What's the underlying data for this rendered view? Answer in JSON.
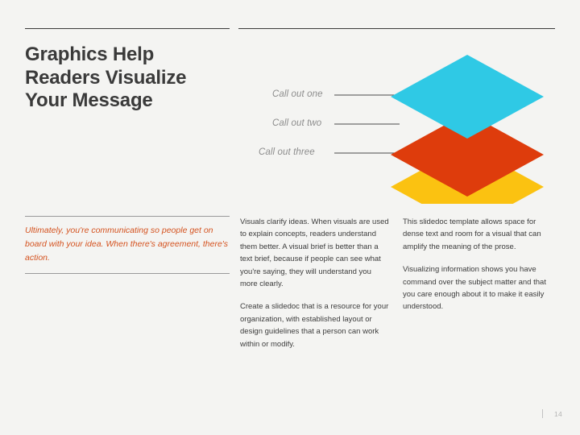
{
  "slide": {
    "background_color": "#f4f4f2",
    "title_lines": [
      "Graphics Help",
      "Readers Visualize",
      "Your Message"
    ],
    "title_color": "#3a3a3a"
  },
  "diagram": {
    "type": "stacked-layers",
    "layers": [
      {
        "label": "Call out one",
        "color": "#2fc9e5"
      },
      {
        "label": "Call out two",
        "color": "#de3c0c"
      },
      {
        "label": "Call out three",
        "color": "#fbc211"
      }
    ],
    "leader_line_color": "#4a4a4a"
  },
  "quote": {
    "text": "Ultimately, you're communicating so people get on board with your idea. When there's agreement, there's action.",
    "color": "#d4521f"
  },
  "columns": {
    "middle": [
      "Visuals clarify ideas. When visuals are used to explain concepts, readers understand them better. A visual brief is better than a text brief, because if people can see what you're saying, they will understand you more clearly.",
      "Create a slidedoc that is a resource for your organization, with established layout or design guidelines that a person can work within or modify."
    ],
    "right": [
      "This slidedoc template allows space for dense text and room for a visual that can amplify the meaning of the prose.",
      "Visualizing information shows you have command over the subject matter and that you care enough about it to make it easily understood."
    ]
  },
  "footer": {
    "page_number": "14"
  }
}
